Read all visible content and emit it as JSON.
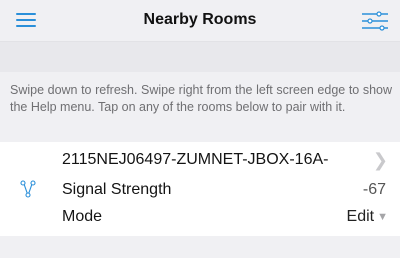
{
  "header": {
    "title": "Nearby Rooms"
  },
  "help": {
    "text": "Swipe down to refresh. Swipe right from the left screen edge to show the Help menu. Tap on any of the rooms below to pair with it."
  },
  "rooms": [
    {
      "name": "2115NEJ06497-ZUMNET-JBOX-16A-",
      "signal_label": "Signal Strength",
      "signal_value": "-67",
      "mode_label": "Mode",
      "mode_value": "Edit",
      "icon": "network-nodes-icon"
    }
  ],
  "colors": {
    "accent": "#2a8fd9",
    "background": "#f0f0f3",
    "card": "#ffffff"
  }
}
